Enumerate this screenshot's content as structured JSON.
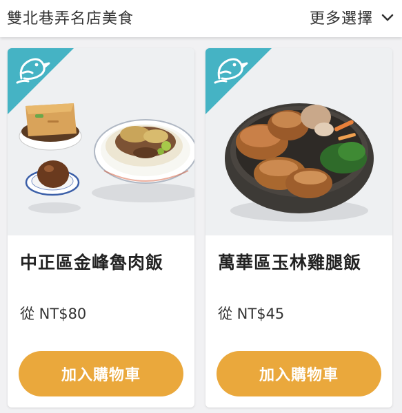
{
  "header": {
    "title": "雙北巷弄名店美食",
    "more_label": "更多選擇",
    "more_icon": "chevron-down-icon"
  },
  "brand": {
    "badge_color": "#45b3c4",
    "button_color": "#eaa83c",
    "badge_icon": "bird-icon"
  },
  "products": [
    {
      "name": "中正區金峰魯肉飯",
      "price": "從 NT$80",
      "add_label": "加入購物車"
    },
    {
      "name": "萬華區玉林雞腿飯",
      "price": "從 NT$45",
      "add_label": "加入購物車"
    }
  ]
}
